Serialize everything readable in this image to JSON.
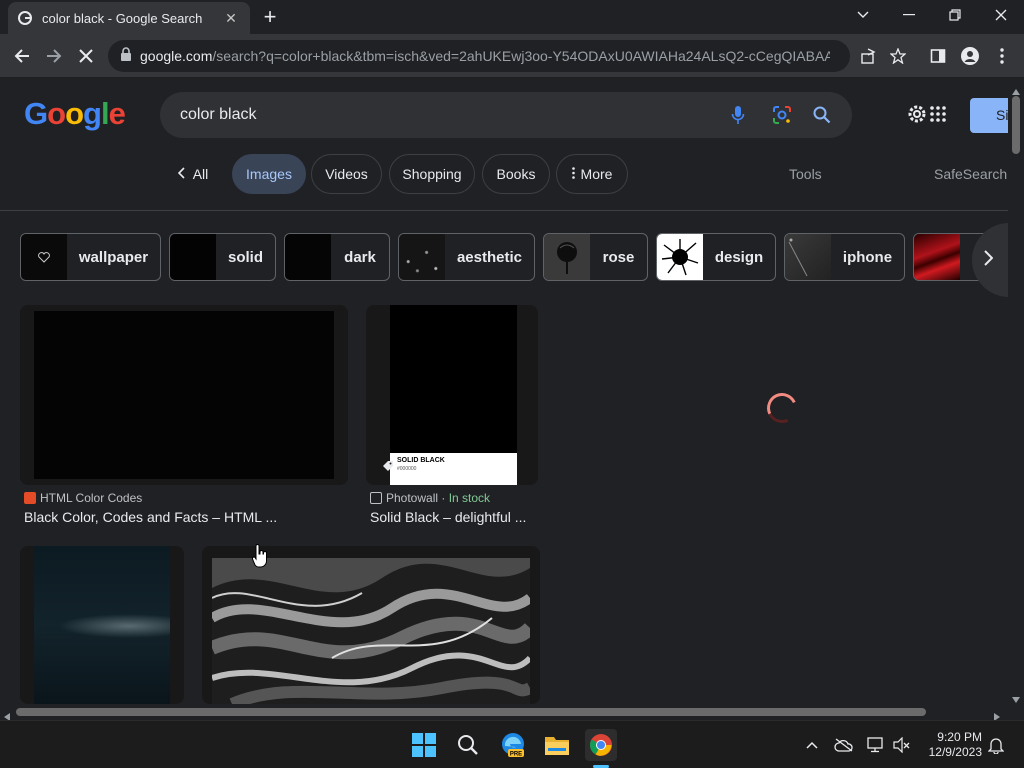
{
  "browser": {
    "tab_title": "color black - Google Search",
    "url_host": "google.com",
    "url_path": "/search?q=color+black&tbm=isch&ved=2ahUKEwj3oo-Y54ODAxU0AWIAHa24ALsQ2-cCegQIABAA..."
  },
  "search": {
    "query": "color black",
    "signin_label": "Si"
  },
  "logo": {
    "letters": [
      "G",
      "o",
      "o",
      "g",
      "l",
      "e"
    ],
    "colors": [
      "#4285f4",
      "#ea4335",
      "#fbbc05",
      "#4285f4",
      "#34a853",
      "#ea4335"
    ]
  },
  "nav": {
    "all": "All",
    "images": "Images",
    "videos": "Videos",
    "shopping": "Shopping",
    "books": "Books",
    "more": "More",
    "tools": "Tools",
    "safesearch": "SafeSearch"
  },
  "filters": [
    {
      "label": "wallpaper",
      "thumb": "#0a0a0a"
    },
    {
      "label": "solid",
      "thumb": "#030303"
    },
    {
      "label": "dark",
      "thumb": "#050505"
    },
    {
      "label": "aesthetic",
      "thumb": "#151515"
    },
    {
      "label": "rose",
      "thumb": "#3a3a3a"
    },
    {
      "label": "design",
      "thumb": "#ffffff"
    },
    {
      "label": "iphone",
      "thumb": "#2d2d2d"
    },
    {
      "label": "",
      "thumb": "#b0121a"
    }
  ],
  "results": [
    {
      "source": "HTML Color Codes",
      "title": "Black Color, Codes and Facts – HTML ...",
      "stock": ""
    },
    {
      "source": "Photowall",
      "title": "Solid Black – delightful ...",
      "stock": "In stock"
    }
  ],
  "thumb2_label": "SOLID BLACK",
  "thumb2_code": "#000000",
  "taskbar": {
    "time": "9:20 PM",
    "date": "12/9/2023"
  },
  "colors": {
    "accent": "#8ab4f8",
    "page_bg": "#202124",
    "chip_active_bg": "#394457"
  }
}
